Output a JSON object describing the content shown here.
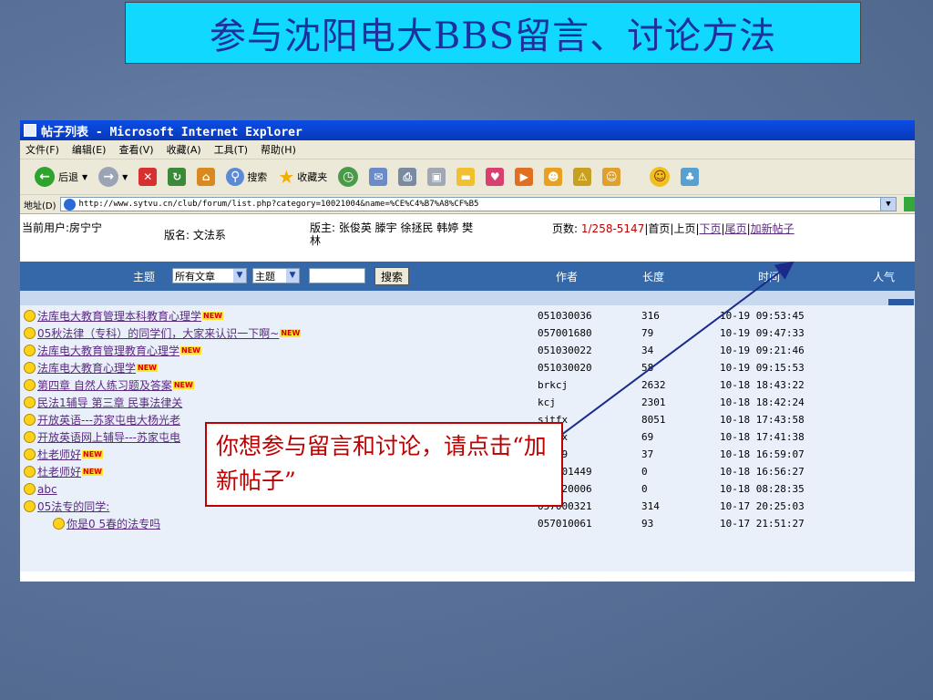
{
  "slide_title": "参与沈阳电大BBS留言、讨论方法",
  "window": {
    "title": "帖子列表 - Microsoft Internet Explorer"
  },
  "menu": [
    "文件(F)",
    "编辑(E)",
    "查看(V)",
    "收藏(A)",
    "工具(T)",
    "帮助(H)"
  ],
  "toolbar": {
    "back": "后退",
    "search": "搜索",
    "favorites": "收藏夹"
  },
  "address": {
    "label": "地址(D)",
    "url": "http://www.sytvu.cn/club/forum/list.php?category=10021004&name=%CE%C4%B7%A8%CF%B5"
  },
  "info": {
    "current_user": "当前用户:房宁宁",
    "board_name": "版名: 文法系",
    "moderators": "版主: 张俊英 滕宇 徐拯民 韩婷 樊林",
    "pages_label": "页数:",
    "pages_value": "1/258-5147",
    "first": "首页",
    "prev": "上页",
    "next": "下页",
    "last": "尾页",
    "new_post": "加新帖子"
  },
  "filter": {
    "topic_label": "主题",
    "scope_value": "所有文章",
    "field_value": "主题",
    "search_button": "搜索",
    "col_author": "作者",
    "col_length": "长度",
    "col_time": "时间",
    "col_people": "人气"
  },
  "posts": [
    {
      "subject": "法库电大教育管理本科教育心理学",
      "new": true,
      "author": "051030036",
      "length": "316",
      "time": "10-19 09:53:45"
    },
    {
      "subject": "05秋法律（专科）的同学们，大家来认识一下啊~",
      "new": true,
      "author": "057001680",
      "length": "79",
      "time": "10-19 09:47:33"
    },
    {
      "subject": "法库电大教育管理教育心理学",
      "new": true,
      "author": "051030022",
      "length": "34",
      "time": "10-19 09:21:46"
    },
    {
      "subject": "法库电大教育心理学",
      "new": true,
      "author": "051030020",
      "length": "58",
      "time": "10-19 09:15:53"
    },
    {
      "subject": "第四章 自然人练习题及答案",
      "new": true,
      "author": "brkcj",
      "length": "2632",
      "time": "10-18 18:43:22"
    },
    {
      "subject": "民法1辅导 第三章 民事法律关",
      "new": false,
      "author": "kcj",
      "length": "2301",
      "time": "10-18 18:42:24"
    },
    {
      "subject": "开放英语---苏家屯电大杨光老",
      "new": false,
      "author": "sjtfx",
      "length": "8051",
      "time": "10-18 17:43:58"
    },
    {
      "subject": "开放英语网上辅导---苏家屯电",
      "new": false,
      "author": "sjtfx",
      "length": "69",
      "time": "10-18 17:41:38"
    },
    {
      "subject": "杜老师好",
      "new": true,
      "author": "01449",
      "length": "37",
      "time": "10-18 16:59:07"
    },
    {
      "subject": "杜老师好",
      "new": true,
      "author": "051001449",
      "length": "0",
      "time": "10-18 16:56:27"
    },
    {
      "subject": "abc",
      "new": false,
      "author": "051020006",
      "length": "0",
      "time": "10-18 08:28:35"
    },
    {
      "subject": "05法专的同学:",
      "new": false,
      "author": "057000321",
      "length": "314",
      "time": "10-17 20:25:03"
    },
    {
      "subject": "你是0 5春的法专吗",
      "new": false,
      "author": "057010061",
      "length": "93",
      "time": "10-17 21:51:27",
      "reply": true
    }
  ],
  "new_badge": "NEW",
  "callout_text": "你想参与留言和讨论，请点击“加新帖子”",
  "colors": {
    "title_bg": "#11d8ff",
    "title_text": "#1e2f9e",
    "callout": "#c00000",
    "header_bar": "#3468a8"
  }
}
